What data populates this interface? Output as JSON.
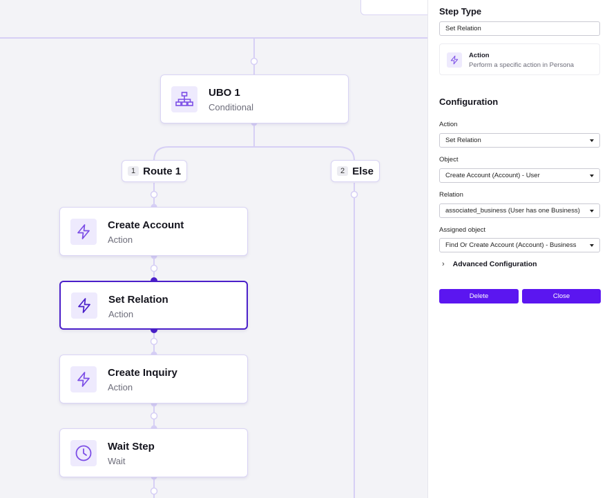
{
  "canvas": {
    "nodes": [
      {
        "id": "ubo",
        "title": "UBO 1",
        "subtitle": "Conditional",
        "icon": "sitemap-icon"
      },
      {
        "id": "create-account",
        "title": "Create Account",
        "subtitle": "Action",
        "icon": "lightning-icon"
      },
      {
        "id": "set-relation",
        "title": "Set Relation",
        "subtitle": "Action",
        "icon": "lightning-icon",
        "selected": true
      },
      {
        "id": "create-inquiry",
        "title": "Create Inquiry",
        "subtitle": "Action",
        "icon": "lightning-icon"
      },
      {
        "id": "wait-step",
        "title": "Wait Step",
        "subtitle": "Wait",
        "icon": "clock-icon"
      }
    ],
    "routes": [
      {
        "number": "1",
        "label": "Route 1"
      },
      {
        "number": "2",
        "label": "Else"
      }
    ]
  },
  "panel": {
    "step_type_label": "Step Type",
    "step_type_value": "Set Relation",
    "card": {
      "title": "Action",
      "description": "Perform a specific action in Persona",
      "icon": "lightning-icon"
    },
    "configuration_label": "Configuration",
    "fields": {
      "action": {
        "label": "Action",
        "value": "Set Relation"
      },
      "object": {
        "label": "Object",
        "value": "Create Account (Account) - User"
      },
      "relation": {
        "label": "Relation",
        "value": "associated_business (User has one Business)"
      },
      "assigned_object": {
        "label": "Assigned object",
        "value": "Find Or Create Account (Account) - Business"
      }
    },
    "advanced_label": "Advanced Configuration",
    "delete_label": "Delete",
    "close_label": "Close"
  },
  "colors": {
    "accent": "#5b16f0",
    "selected_border": "#4a1fc9",
    "wire": "#d6cff5",
    "icon_purple": "#7c4ee6"
  }
}
